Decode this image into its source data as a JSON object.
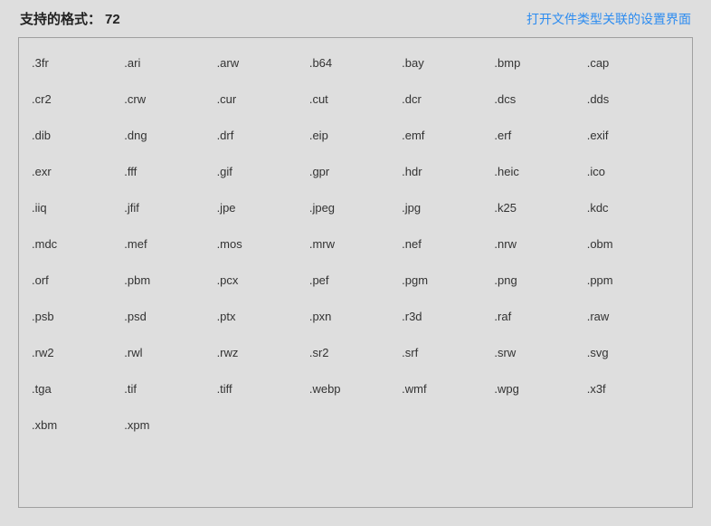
{
  "header": {
    "title_label": "支持的格式：",
    "count": 72,
    "link_label": "打开文件类型关联的设置界面"
  },
  "formats": [
    ".3fr",
    ".ari",
    ".arw",
    ".b64",
    ".bay",
    ".bmp",
    ".cap",
    ".cr2",
    ".crw",
    ".cur",
    ".cut",
    ".dcr",
    ".dcs",
    ".dds",
    ".dib",
    ".dng",
    ".drf",
    ".eip",
    ".emf",
    ".erf",
    ".exif",
    ".exr",
    ".fff",
    ".gif",
    ".gpr",
    ".hdr",
    ".heic",
    ".ico",
    ".iiq",
    ".jfif",
    ".jpe",
    ".jpeg",
    ".jpg",
    ".k25",
    ".kdc",
    ".mdc",
    ".mef",
    ".mos",
    ".mrw",
    ".nef",
    ".nrw",
    ".obm",
    ".orf",
    ".pbm",
    ".pcx",
    ".pef",
    ".pgm",
    ".png",
    ".ppm",
    ".psb",
    ".psd",
    ".ptx",
    ".pxn",
    ".r3d",
    ".raf",
    ".raw",
    ".rw2",
    ".rwl",
    ".rwz",
    ".sr2",
    ".srf",
    ".srw",
    ".svg",
    ".tga",
    ".tif",
    ".tiff",
    ".webp",
    ".wmf",
    ".wpg",
    ".x3f",
    ".xbm",
    ".xpm"
  ]
}
